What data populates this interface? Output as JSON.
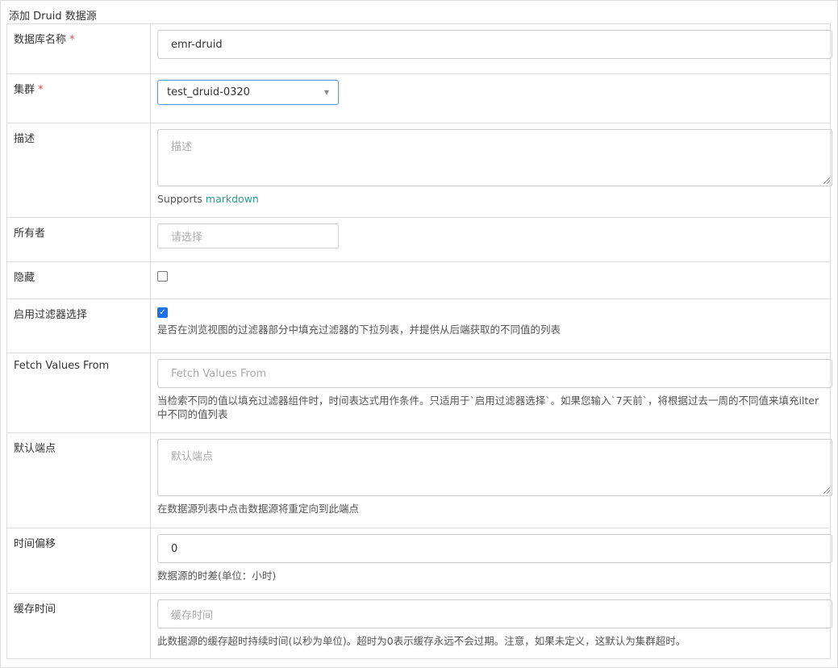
{
  "panel": {
    "title": "添加 Druid 数据源"
  },
  "rows": {
    "name": {
      "label": "数据库名称",
      "required": "*",
      "value": "emr-druid"
    },
    "cluster": {
      "label": "集群",
      "required": "*",
      "value": "test_druid-0320"
    },
    "description": {
      "label": "描述",
      "placeholder": "描述",
      "help_prefix": "Supports ",
      "help_link": "markdown"
    },
    "owner": {
      "label": "所有者",
      "placeholder": "请选择"
    },
    "hidden": {
      "label": "隐藏",
      "checked": false
    },
    "filter_select": {
      "label": "启用过滤器选择",
      "checked": true,
      "help": "是否在浏览视图的过滤器部分中填充过滤器的下拉列表，并提供从后端获取的不同值的列表"
    },
    "fetch_values": {
      "label": "Fetch Values From",
      "placeholder": "Fetch Values From",
      "help": "当检索不同的值以填充过滤器组件时，时间表达式用作条件。只适用于`启用过滤器选择`。如果您输入`7天前`，将根据过去一周的不同值来填充ilter中不同的值列表"
    },
    "endpoint": {
      "label": "默认端点",
      "placeholder": "默认端点",
      "help": "在数据源列表中点击数据源将重定向到此端点"
    },
    "offset": {
      "label": "时间偏移",
      "value": "0",
      "help": "数据源的时差(单位：小时)"
    },
    "cache": {
      "label": "缓存时间",
      "placeholder": "缓存时间",
      "help": "此数据源的缓存超时持续时间(以秒为单位)。超时为0表示缓存永远不会过期。注意，如果未定义，这默认为集群超时。"
    }
  },
  "colors": {
    "link": "#2a9d8f",
    "required": "#e04646",
    "checkbox": "#1a73e8"
  }
}
